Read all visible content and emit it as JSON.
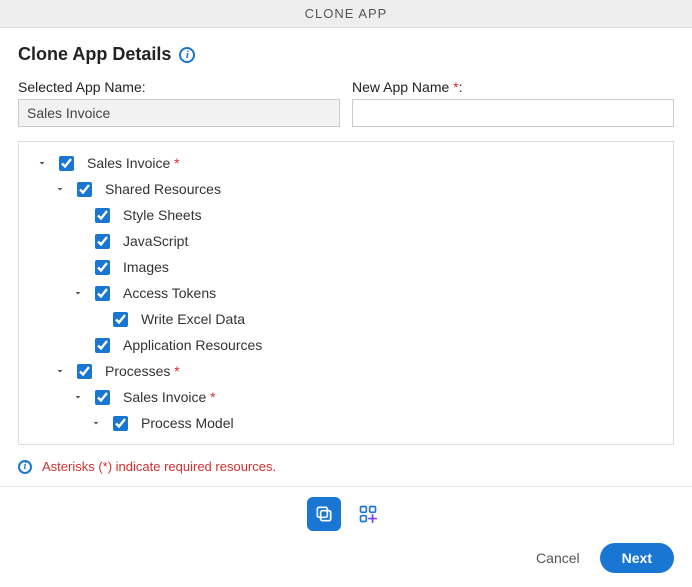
{
  "header": {
    "title": "CLONE APP"
  },
  "page": {
    "title": "Clone App Details"
  },
  "fields": {
    "selected_label": "Selected App Name:",
    "selected_value": "Sales Invoice",
    "new_label": "New App Name ",
    "new_required_suffix": "*",
    "new_label_colon": ":",
    "new_value": ""
  },
  "tree": {
    "n0": {
      "label": "Sales Invoice ",
      "req": "*"
    },
    "n1": {
      "label": "Shared Resources"
    },
    "n2": {
      "label": "Style Sheets"
    },
    "n3": {
      "label": "JavaScript"
    },
    "n4": {
      "label": "Images"
    },
    "n5": {
      "label": "Access Tokens"
    },
    "n6": {
      "label": "Write Excel Data"
    },
    "n7": {
      "label": "Application Resources"
    },
    "n8": {
      "label": "Processes ",
      "req": "*"
    },
    "n9": {
      "label": "Sales Invoice ",
      "req": "*"
    },
    "n10": {
      "label": "Process Model"
    }
  },
  "footnote": "Asterisks (*) indicate required resources.",
  "buttons": {
    "cancel": "Cancel",
    "next": "Next"
  }
}
